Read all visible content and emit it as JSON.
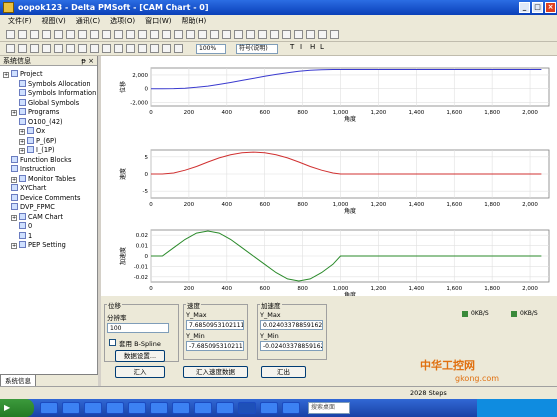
{
  "window": {
    "title": "oopok123 - Delta PMSoft - [CAM Chart - 0]"
  },
  "menu": [
    "文件(F)",
    "视图(V)",
    "通讯(C)",
    "选项(O)",
    "窗口(W)",
    "帮助(H)"
  ],
  "toolbar2": {
    "zoom": "100%",
    "comment_mode": "符号(说明)",
    "letters": [
      "T",
      "I",
      "H",
      "L"
    ]
  },
  "sidebar": {
    "title": "系统信息",
    "pin": "ᵽ ×",
    "tab": "系统信息",
    "items": [
      {
        "label": "Project"
      },
      {
        "label": "Symbols Allocation"
      },
      {
        "label": "Symbols Information"
      },
      {
        "label": "Global Symbols"
      },
      {
        "label": "Programs"
      },
      {
        "label": "O100_(42)"
      },
      {
        "label": "Ox"
      },
      {
        "label": "P_(6P)"
      },
      {
        "label": "I_(1P)"
      },
      {
        "label": "Function Blocks"
      },
      {
        "label": "Instruction"
      },
      {
        "label": "Monitor Tables"
      },
      {
        "label": "XYChart"
      },
      {
        "label": "Device Comments"
      },
      {
        "label": "DVP_FPMC"
      },
      {
        "label": "CAM Chart"
      },
      {
        "label": "0"
      },
      {
        "label": "1"
      },
      {
        "label": "PEP Setting"
      }
    ]
  },
  "chart_data": [
    {
      "type": "line",
      "ylabel": "位移",
      "xlabel": "角度",
      "xlim": [
        0,
        2100
      ],
      "ylim": [
        -2500,
        3000
      ],
      "yticks": [
        "2,000",
        "0",
        "-2,000"
      ],
      "ytick_vals": [
        2000,
        0,
        -2000
      ],
      "xticks": [
        "0",
        "200",
        "400",
        "600",
        "800",
        "1,000",
        "1,200",
        "1,400",
        "1,600",
        "1,800",
        "2,000"
      ],
      "color": "#3a3acf",
      "x": [
        0,
        60,
        120,
        180,
        240,
        300,
        360,
        420,
        480,
        540,
        600,
        660,
        720,
        780,
        840,
        900,
        960,
        1000,
        1100,
        1200,
        1300,
        1400,
        1500,
        1600,
        1700,
        1800,
        1900,
        2000,
        2060
      ],
      "y": [
        0,
        0,
        20,
        80,
        200,
        380,
        620,
        900,
        1200,
        1500,
        1800,
        2080,
        2320,
        2520,
        2660,
        2740,
        2780,
        2790,
        2790,
        2790,
        2790,
        2790,
        2790,
        2790,
        2790,
        2790,
        2790,
        2790,
        2790
      ]
    },
    {
      "type": "line",
      "ylabel": "速度",
      "xlabel": "角度",
      "xlim": [
        0,
        2100
      ],
      "ylim": [
        -7,
        7
      ],
      "yticks": [
        "5",
        "0",
        "-5"
      ],
      "ytick_vals": [
        5,
        0,
        -5
      ],
      "xticks": [
        "0",
        "200",
        "400",
        "600",
        "800",
        "1,000",
        "1,200",
        "1,400",
        "1,600",
        "1,800",
        "2,000"
      ],
      "color": "#d03030",
      "x": [
        0,
        60,
        120,
        180,
        240,
        300,
        360,
        420,
        480,
        540,
        600,
        660,
        720,
        780,
        840,
        900,
        960,
        1000,
        1100,
        1200,
        1300,
        1400,
        1500,
        1600,
        1700,
        1800,
        1900,
        2000,
        2060
      ],
      "y": [
        0,
        0,
        0.3,
        1.1,
        2.2,
        3.5,
        4.7,
        5.6,
        6.2,
        6.4,
        6.2,
        5.6,
        4.7,
        3.5,
        2.2,
        1.1,
        0.3,
        0,
        0,
        0,
        0,
        0,
        0,
        0,
        0,
        0,
        0,
        0,
        0
      ]
    },
    {
      "type": "line",
      "ylabel": "加速度",
      "xlabel": "角度",
      "xlim": [
        0,
        2100
      ],
      "ylim": [
        -0.025,
        0.025
      ],
      "yticks": [
        "0.02",
        "0.01",
        "0",
        "-0.01",
        "-0.02"
      ],
      "ytick_vals": [
        0.02,
        0.01,
        0,
        -0.01,
        -0.02
      ],
      "xticks": [
        "0",
        "200",
        "400",
        "600",
        "800",
        "1,000",
        "1,200",
        "1,400",
        "1,600",
        "1,800",
        "2,000"
      ],
      "color": "#2a8a2a",
      "x": [
        0,
        60,
        120,
        180,
        240,
        300,
        360,
        420,
        480,
        540,
        600,
        660,
        720,
        780,
        840,
        900,
        960,
        1000,
        1100,
        1200,
        1300,
        1400,
        1500,
        1600,
        1700,
        1800,
        1900,
        2000,
        2060
      ],
      "y": [
        0,
        0,
        0.008,
        0.016,
        0.022,
        0.024,
        0.022,
        0.016,
        0.008,
        0,
        -0.008,
        -0.016,
        -0.022,
        -0.024,
        -0.022,
        -0.016,
        -0.008,
        0,
        0,
        0,
        0,
        0,
        0,
        0,
        0,
        0,
        0,
        0,
        0
      ]
    }
  ],
  "bottom": {
    "pos_label": "位移",
    "res_label": "分辨率",
    "res_value": "100",
    "bspline": "套用 B-Spline",
    "data_settings_btn": "数据设置...",
    "speed_label": "速度",
    "ymax_label": "Y_Max",
    "speed_ymax": "7.68509531021118",
    "ymin_label": "Y_Min",
    "speed_ymin": "-7.68509531021118",
    "acc_label": "加速度",
    "acc_ymax": "0.0240337885916233",
    "acc_ymin": "-0.0240337885916233",
    "import_btn": "汇入",
    "import_speed_btn": "汇入速度数据",
    "export_btn": "汇出"
  },
  "com": {
    "rx": "0KB/S",
    "tx": "0KB/S"
  },
  "status": {
    "text": "2028 Steps"
  },
  "taskbar": {
    "search_placeholder": "搜索桌面"
  },
  "watermark": {
    "line1": "中华工控网",
    "line2": "gkong.com"
  }
}
